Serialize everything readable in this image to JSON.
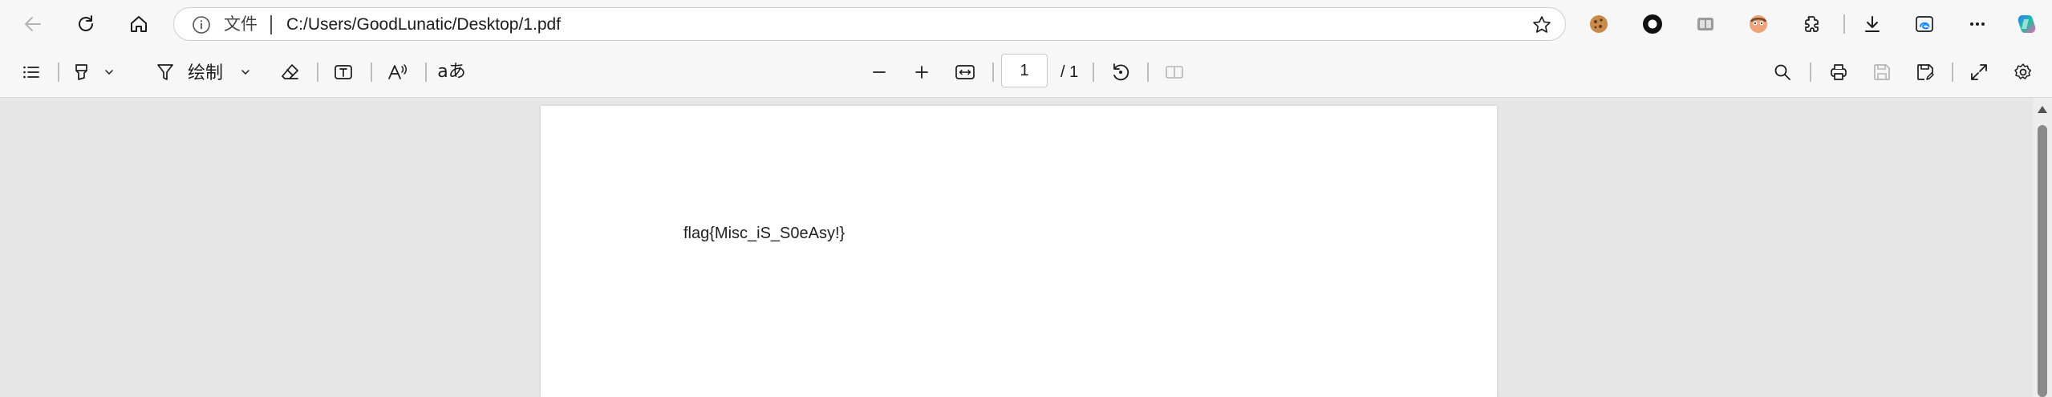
{
  "browser": {
    "address_bar": {
      "scheme_label": "文件",
      "url": "C:/Users/GoodLunatic/Desktop/1.pdf"
    }
  },
  "pdf_toolbar": {
    "draw_label": "绘制",
    "current_page": "1",
    "total_pages": "/ 1",
    "translate_glyph": "aあ"
  },
  "document": {
    "text": "flag{Misc_iS_S0eAsy!}"
  },
  "colors": {
    "copilot_gradient_start": "#2e7cf6",
    "copilot_gradient_end": "#f95bb1",
    "toolbar_bg": "#f7f7f7",
    "viewer_bg": "#e6e6e6"
  }
}
